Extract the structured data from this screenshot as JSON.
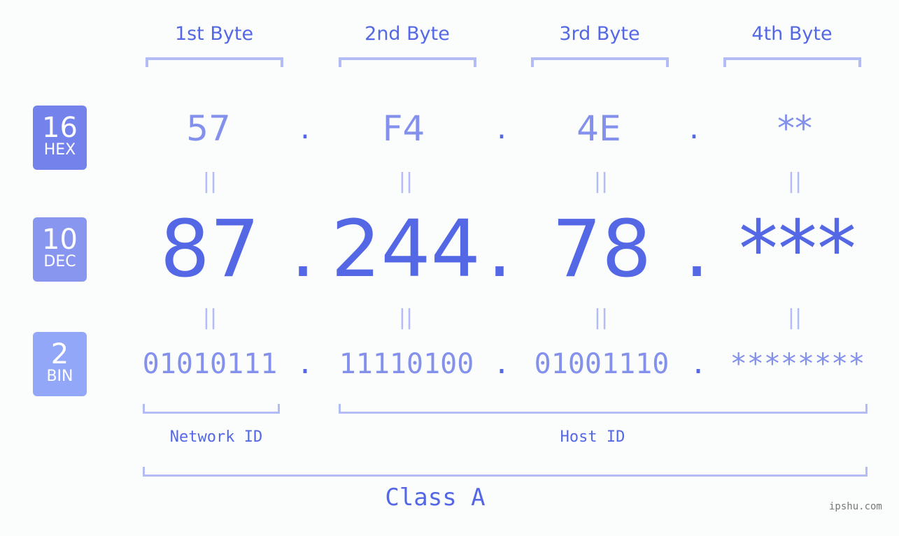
{
  "headers": [
    "1st Byte",
    "2nd Byte",
    "3rd Byte",
    "4th Byte"
  ],
  "badges": {
    "hex": {
      "num": "16",
      "label": "HEX",
      "color": "#7482ec"
    },
    "dec": {
      "num": "10",
      "label": "DEC",
      "color": "#8896f0"
    },
    "bin": {
      "num": "2",
      "label": "BIN",
      "color": "#93a7f8"
    }
  },
  "hex": [
    "57",
    "F4",
    "4E",
    "**"
  ],
  "dec": [
    "87",
    "244",
    "78",
    "***"
  ],
  "bin": [
    "01010111",
    "11110100",
    "01001110",
    "********"
  ],
  "separator": ".",
  "equals": "=",
  "network_label": "Network ID",
  "host_label": "Host ID",
  "class_label": "Class A",
  "watermark": "ipshu.com"
}
